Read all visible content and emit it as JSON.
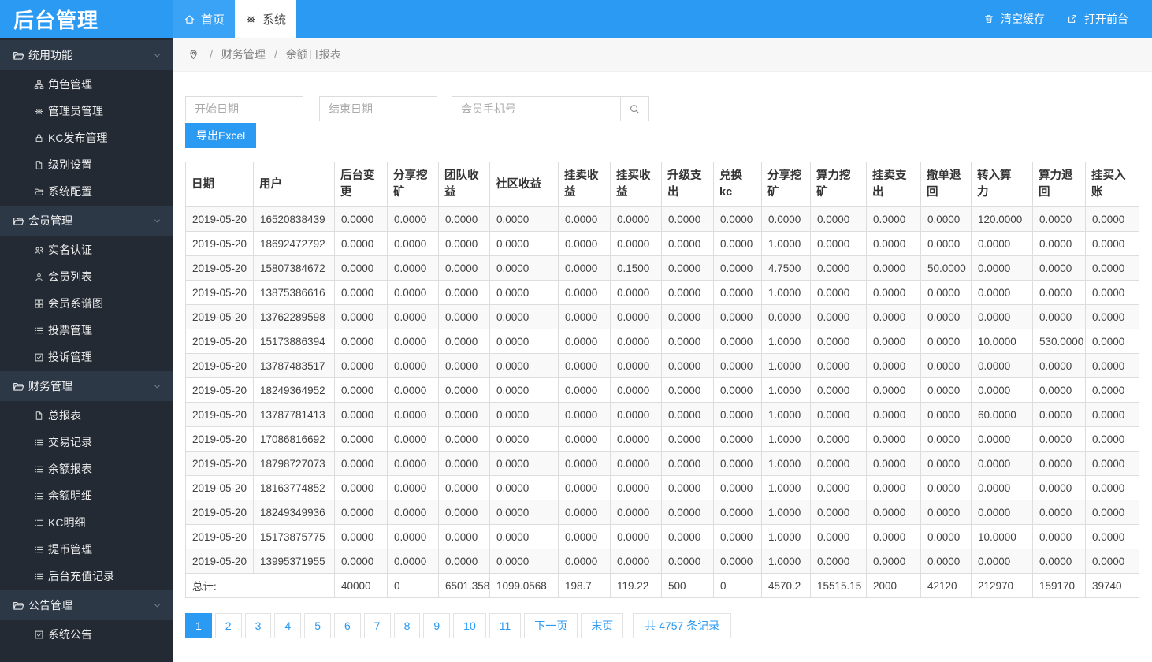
{
  "app": {
    "title": "后台管理"
  },
  "topnav": {
    "tabs": [
      {
        "label": "首页",
        "icon": "home",
        "active": false
      },
      {
        "label": "系统",
        "icon": "gear",
        "active": true
      }
    ],
    "actions": [
      {
        "label": "清空缓存",
        "icon": "trash"
      },
      {
        "label": "打开前台",
        "icon": "external-link"
      }
    ]
  },
  "sidebar": {
    "sections": [
      {
        "label": "统用功能",
        "icon": "folder",
        "items": [
          {
            "label": "角色管理",
            "icon": "sitemap"
          },
          {
            "label": "管理员管理",
            "icon": "gear"
          },
          {
            "label": "KC发布管理",
            "icon": "lock"
          },
          {
            "label": "级别设置",
            "icon": "file"
          },
          {
            "label": "系统配置",
            "icon": "folder"
          }
        ]
      },
      {
        "label": "会员管理",
        "icon": "folder",
        "items": [
          {
            "label": "实名认证",
            "icon": "users"
          },
          {
            "label": "会员列表",
            "icon": "user"
          },
          {
            "label": "会员系谱图",
            "icon": "grid"
          },
          {
            "label": "投票管理",
            "icon": "list"
          },
          {
            "label": "投诉管理",
            "icon": "check-square"
          }
        ]
      },
      {
        "label": "财务管理",
        "icon": "folder",
        "items": [
          {
            "label": "总报表",
            "icon": "file"
          },
          {
            "label": "交易记录",
            "icon": "list"
          },
          {
            "label": "余额报表",
            "icon": "list"
          },
          {
            "label": "余额明细",
            "icon": "list"
          },
          {
            "label": "KC明细",
            "icon": "list"
          },
          {
            "label": "提币管理",
            "icon": "list"
          },
          {
            "label": "后台充值记录",
            "icon": "list"
          }
        ]
      },
      {
        "label": "公告管理",
        "icon": "folder",
        "items": [
          {
            "label": "系统公告",
            "icon": "check-square"
          }
        ]
      }
    ]
  },
  "breadcrumb": {
    "items": [
      "财务管理",
      "余额日报表"
    ]
  },
  "filters": {
    "start_date_placeholder": "开始日期",
    "end_date_placeholder": "结束日期",
    "phone_placeholder": "会员手机号",
    "export_label": "导出Excel"
  },
  "table": {
    "columns": [
      "日期",
      "用户",
      "后台变\n更",
      "分享挖\n矿",
      "团队收\n益",
      "社区收益",
      "挂卖收\n益",
      "挂买收\n益",
      "升级支\n出",
      "兑换\nkc",
      "分享挖\n矿",
      "算力挖\n矿",
      "挂卖支\n出",
      "撤单退\n回",
      "转入算\n力",
      "算力退\n回",
      "挂买入\n账"
    ],
    "rows": [
      [
        "2019-05-20",
        "16520838439",
        "0.0000",
        "0.0000",
        "0.0000",
        "0.0000",
        "0.0000",
        "0.0000",
        "0.0000",
        "0.0000",
        "0.0000",
        "0.0000",
        "0.0000",
        "0.0000",
        "120.0000",
        "0.0000",
        "0.0000"
      ],
      [
        "2019-05-20",
        "18692472792",
        "0.0000",
        "0.0000",
        "0.0000",
        "0.0000",
        "0.0000",
        "0.0000",
        "0.0000",
        "0.0000",
        "1.0000",
        "0.0000",
        "0.0000",
        "0.0000",
        "0.0000",
        "0.0000",
        "0.0000"
      ],
      [
        "2019-05-20",
        "15807384672",
        "0.0000",
        "0.0000",
        "0.0000",
        "0.0000",
        "0.0000",
        "0.1500",
        "0.0000",
        "0.0000",
        "4.7500",
        "0.0000",
        "0.0000",
        "50.0000",
        "0.0000",
        "0.0000",
        "0.0000"
      ],
      [
        "2019-05-20",
        "13875386616",
        "0.0000",
        "0.0000",
        "0.0000",
        "0.0000",
        "0.0000",
        "0.0000",
        "0.0000",
        "0.0000",
        "1.0000",
        "0.0000",
        "0.0000",
        "0.0000",
        "0.0000",
        "0.0000",
        "0.0000"
      ],
      [
        "2019-05-20",
        "13762289598",
        "0.0000",
        "0.0000",
        "0.0000",
        "0.0000",
        "0.0000",
        "0.0000",
        "0.0000",
        "0.0000",
        "0.0000",
        "0.0000",
        "0.0000",
        "0.0000",
        "0.0000",
        "0.0000",
        "0.0000"
      ],
      [
        "2019-05-20",
        "15173886394",
        "0.0000",
        "0.0000",
        "0.0000",
        "0.0000",
        "0.0000",
        "0.0000",
        "0.0000",
        "0.0000",
        "1.0000",
        "0.0000",
        "0.0000",
        "0.0000",
        "10.0000",
        "530.0000",
        "0.0000"
      ],
      [
        "2019-05-20",
        "13787483517",
        "0.0000",
        "0.0000",
        "0.0000",
        "0.0000",
        "0.0000",
        "0.0000",
        "0.0000",
        "0.0000",
        "1.0000",
        "0.0000",
        "0.0000",
        "0.0000",
        "0.0000",
        "0.0000",
        "0.0000"
      ],
      [
        "2019-05-20",
        "18249364952",
        "0.0000",
        "0.0000",
        "0.0000",
        "0.0000",
        "0.0000",
        "0.0000",
        "0.0000",
        "0.0000",
        "1.0000",
        "0.0000",
        "0.0000",
        "0.0000",
        "0.0000",
        "0.0000",
        "0.0000"
      ],
      [
        "2019-05-20",
        "13787781413",
        "0.0000",
        "0.0000",
        "0.0000",
        "0.0000",
        "0.0000",
        "0.0000",
        "0.0000",
        "0.0000",
        "1.0000",
        "0.0000",
        "0.0000",
        "0.0000",
        "60.0000",
        "0.0000",
        "0.0000"
      ],
      [
        "2019-05-20",
        "17086816692",
        "0.0000",
        "0.0000",
        "0.0000",
        "0.0000",
        "0.0000",
        "0.0000",
        "0.0000",
        "0.0000",
        "1.0000",
        "0.0000",
        "0.0000",
        "0.0000",
        "0.0000",
        "0.0000",
        "0.0000"
      ],
      [
        "2019-05-20",
        "18798727073",
        "0.0000",
        "0.0000",
        "0.0000",
        "0.0000",
        "0.0000",
        "0.0000",
        "0.0000",
        "0.0000",
        "1.0000",
        "0.0000",
        "0.0000",
        "0.0000",
        "0.0000",
        "0.0000",
        "0.0000"
      ],
      [
        "2019-05-20",
        "18163774852",
        "0.0000",
        "0.0000",
        "0.0000",
        "0.0000",
        "0.0000",
        "0.0000",
        "0.0000",
        "0.0000",
        "1.0000",
        "0.0000",
        "0.0000",
        "0.0000",
        "0.0000",
        "0.0000",
        "0.0000"
      ],
      [
        "2019-05-20",
        "18249349936",
        "0.0000",
        "0.0000",
        "0.0000",
        "0.0000",
        "0.0000",
        "0.0000",
        "0.0000",
        "0.0000",
        "1.0000",
        "0.0000",
        "0.0000",
        "0.0000",
        "0.0000",
        "0.0000",
        "0.0000"
      ],
      [
        "2019-05-20",
        "15173875775",
        "0.0000",
        "0.0000",
        "0.0000",
        "0.0000",
        "0.0000",
        "0.0000",
        "0.0000",
        "0.0000",
        "1.0000",
        "0.0000",
        "0.0000",
        "0.0000",
        "10.0000",
        "0.0000",
        "0.0000"
      ],
      [
        "2019-05-20",
        "13995371955",
        "0.0000",
        "0.0000",
        "0.0000",
        "0.0000",
        "0.0000",
        "0.0000",
        "0.0000",
        "0.0000",
        "1.0000",
        "0.0000",
        "0.0000",
        "0.0000",
        "0.0000",
        "0.0000",
        "0.0000"
      ]
    ],
    "total_label": "总计:",
    "totals": [
      "40000",
      "0",
      "6501.358",
      "1099.0568",
      "198.7",
      "119.22",
      "500",
      "0",
      "4570.2",
      "15515.15",
      "2000",
      "42120",
      "212970",
      "159170",
      "39740"
    ]
  },
  "pagination": {
    "pages": [
      "1",
      "2",
      "3",
      "4",
      "5",
      "6",
      "7",
      "8",
      "9",
      "10",
      "11"
    ],
    "active": "1",
    "next_label": "下一页",
    "last_label": "末页",
    "count_label": "共 4757 条记录"
  }
}
